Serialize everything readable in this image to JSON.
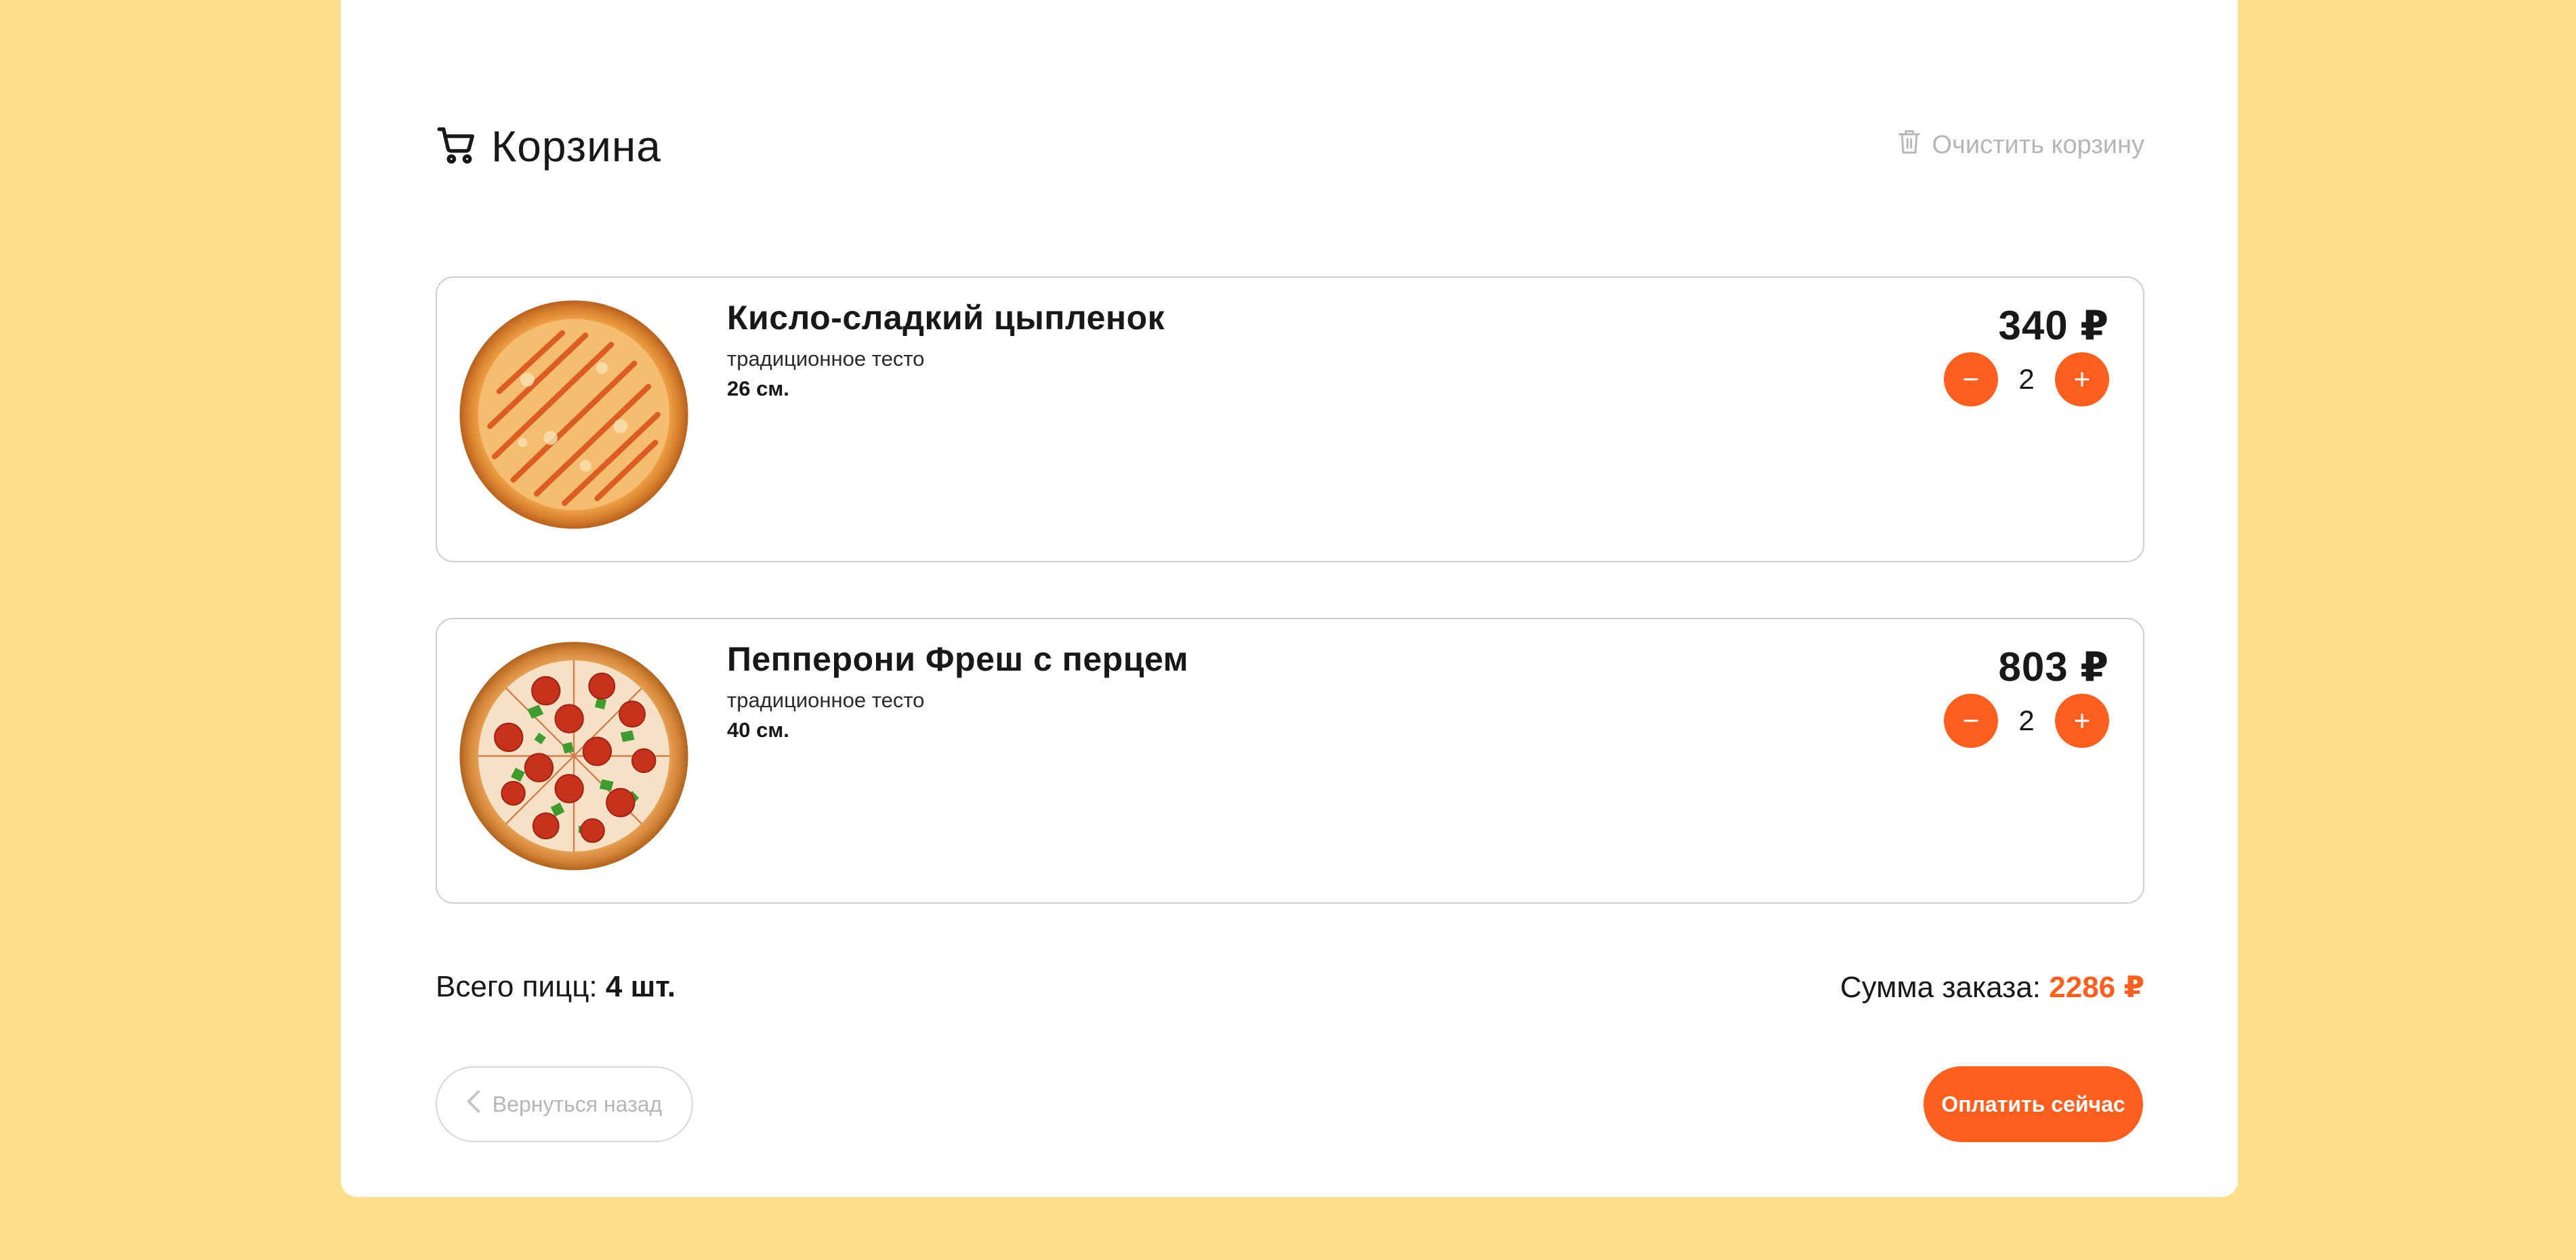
{
  "header": {
    "title": "Корзина",
    "clear_label": "Очистить корзину"
  },
  "items": [
    {
      "name": "Кисло-сладкий цыпленок",
      "dough": "традиционное тесто",
      "size": "26 см.",
      "price": "340 ₽",
      "quantity": "2",
      "image": "pizza-sweet-sour-chicken"
    },
    {
      "name": "Пепперони Фреш с перцем",
      "dough": "традиционное тесто",
      "size": "40 см.",
      "price": "803 ₽",
      "quantity": "2",
      "image": "pizza-pepperoni-fresh"
    }
  ],
  "summary": {
    "count_label": "Всего пицц:",
    "count_value": "4 шт.",
    "sum_label": "Сумма заказа:",
    "sum_value": "2286 ₽"
  },
  "actions": {
    "back_label": "Вернуться назад",
    "pay_label": "Оплатить сейчас"
  },
  "colors": {
    "background": "#FFDF8C",
    "accent": "#FE5F1E",
    "muted": "#B6B6B6"
  }
}
